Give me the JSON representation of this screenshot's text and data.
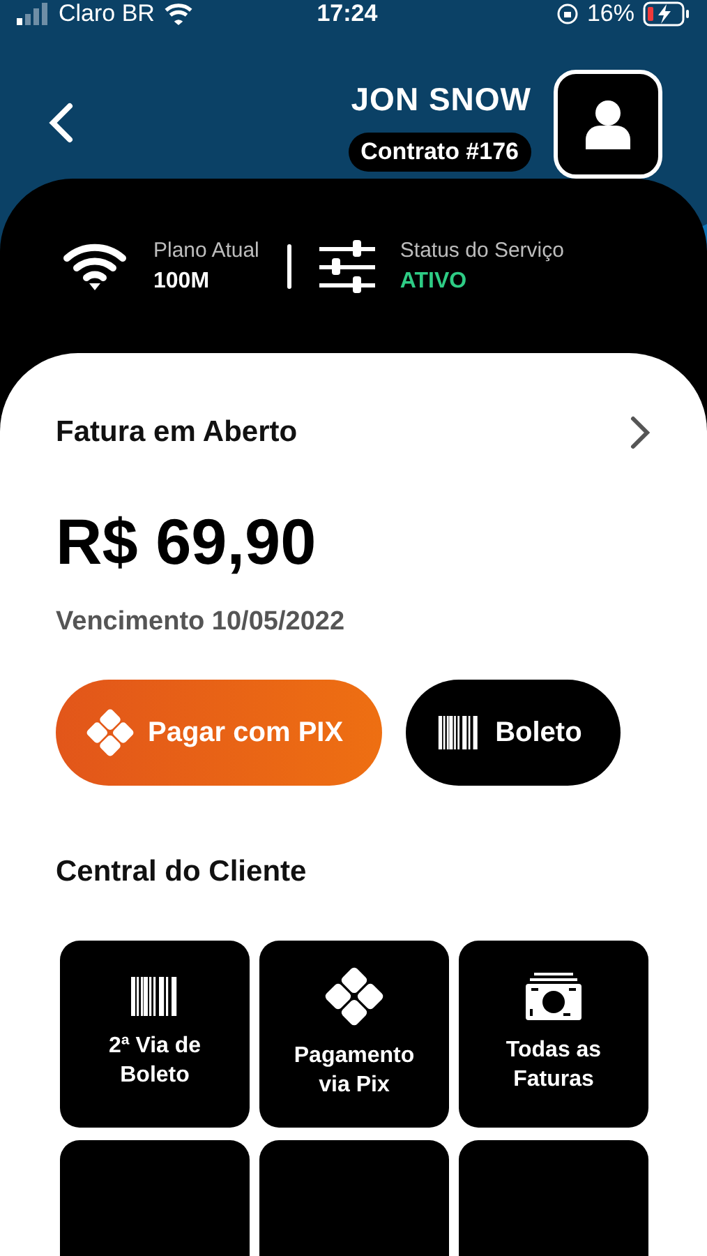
{
  "status_bar": {
    "carrier": "Claro BR",
    "time": "17:24",
    "battery": "16%"
  },
  "header": {
    "name": "JON SNOW",
    "contract": "Contrato #176"
  },
  "service_info": [
    {
      "kind": "wifi",
      "label": "Plano Atual",
      "value": "100M"
    },
    {
      "kind": "sliders",
      "label": "Status do Serviço",
      "value": "ATIVO"
    }
  ],
  "invoice": {
    "title": "Fatura em Aberto",
    "amount": "R$ 69,90",
    "due": "Vencimento 10/05/2022"
  },
  "actions": [
    {
      "kind": "pix",
      "label": "Pagar com PIX"
    },
    {
      "kind": "barcode",
      "label": "Boleto"
    }
  ],
  "customer_center": {
    "title": "Central do Cliente",
    "tiles": [
      {
        "kind": "barcode",
        "label": "2ª Via de Boleto"
      },
      {
        "kind": "pix",
        "label": "Pagamento via Pix"
      },
      {
        "kind": "money",
        "label": "Todas as Faturas"
      }
    ]
  }
}
